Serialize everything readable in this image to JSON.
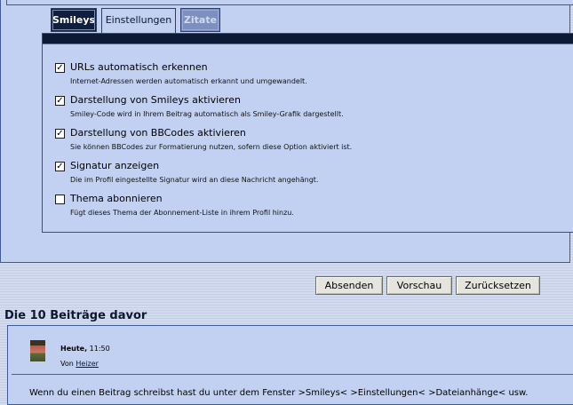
{
  "tabs": {
    "smileys": "Smileys",
    "settings": "Einstellungen",
    "quotes": "Zitate"
  },
  "options": [
    {
      "title": "URLs automatisch erkennen",
      "description": "Internet-Adressen werden automatisch erkannt und umgewandelt.",
      "checked": true
    },
    {
      "title": "Darstellung von Smileys aktivieren",
      "description": "Smiley-Code wird in Ihrem Beitrag automatisch als Smiley-Grafik dargestellt.",
      "checked": true
    },
    {
      "title": "Darstellung von BBCodes aktivieren",
      "description": "Sie können BBCodes zur Formatierung nutzen, sofern diese Option aktiviert ist.",
      "checked": true
    },
    {
      "title": "Signatur anzeigen",
      "description": "Die im Profil eingestellte Signatur wird an diese Nachricht angehängt.",
      "checked": true
    },
    {
      "title": "Thema abonnieren",
      "description": "Fügt dieses Thema der Abonnement-Liste in ihrem Profil hinzu.",
      "checked": false
    }
  ],
  "buttons": {
    "send": "Absenden",
    "preview": "Vorschau",
    "reset": "Zurücksetzen"
  },
  "previous_posts": {
    "heading": "Die 10 Beiträge davor",
    "post": {
      "date_bold": "Heute,",
      "time": " 11:50",
      "by_label": "Von ",
      "author": "Heizer",
      "body": "Wenn du einen Beitrag schreibst hast du unter dem Fenster >Smileys< >Einstellungen< >Dateianhänge< usw."
    }
  }
}
